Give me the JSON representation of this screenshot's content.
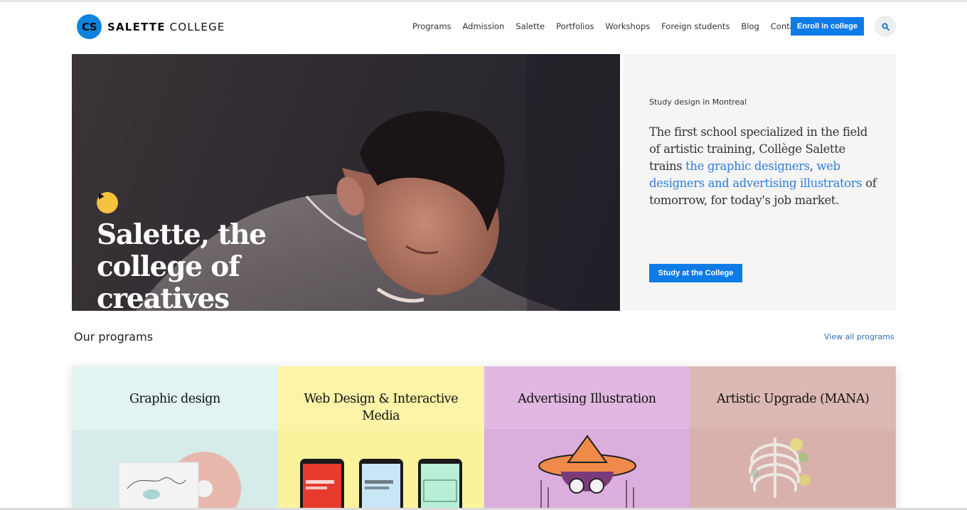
{
  "header": {
    "logo_badge": "CS",
    "logo_name_bold": "SALETTE",
    "logo_name_rest": " COLLEGE",
    "nav": [
      "Programs",
      "Admission",
      "Salette",
      "Portfolios",
      "Workshops",
      "Foreign students",
      "Blog",
      "Contact"
    ],
    "enroll_label": "Enroll in college",
    "search_icon": "search-icon"
  },
  "hero": {
    "title": "Salette, the college of creatives",
    "play_icon": "play-icon",
    "kicker": "Study design in Montreal",
    "desc_part1": "The first school specialized in the field of artistic training, Collège Salette trains ",
    "desc_link1": "the graphic designers",
    "desc_part2": ", ",
    "desc_link2": "web designers and advertising illustrators",
    "desc_part3": " of tomorrow, for today's job market.",
    "cta_label": "Study at the College"
  },
  "programs": {
    "heading": "Our programs",
    "view_all": "View all programs",
    "cards": [
      {
        "title": "Graphic design",
        "bg": "#e3f3f1"
      },
      {
        "title": "Web Design & Interactive Media",
        "bg": "#fdf4a8"
      },
      {
        "title": "Advertising Illustration",
        "bg": "#e1b8e1"
      },
      {
        "title": "Artistic Upgrade (MANA)",
        "bg": "#dcb8b5"
      }
    ]
  },
  "colors": {
    "accent": "#0f7be6",
    "logo": "#0d83dd",
    "play": "#f4c23f",
    "link": "#2e7fd6"
  }
}
